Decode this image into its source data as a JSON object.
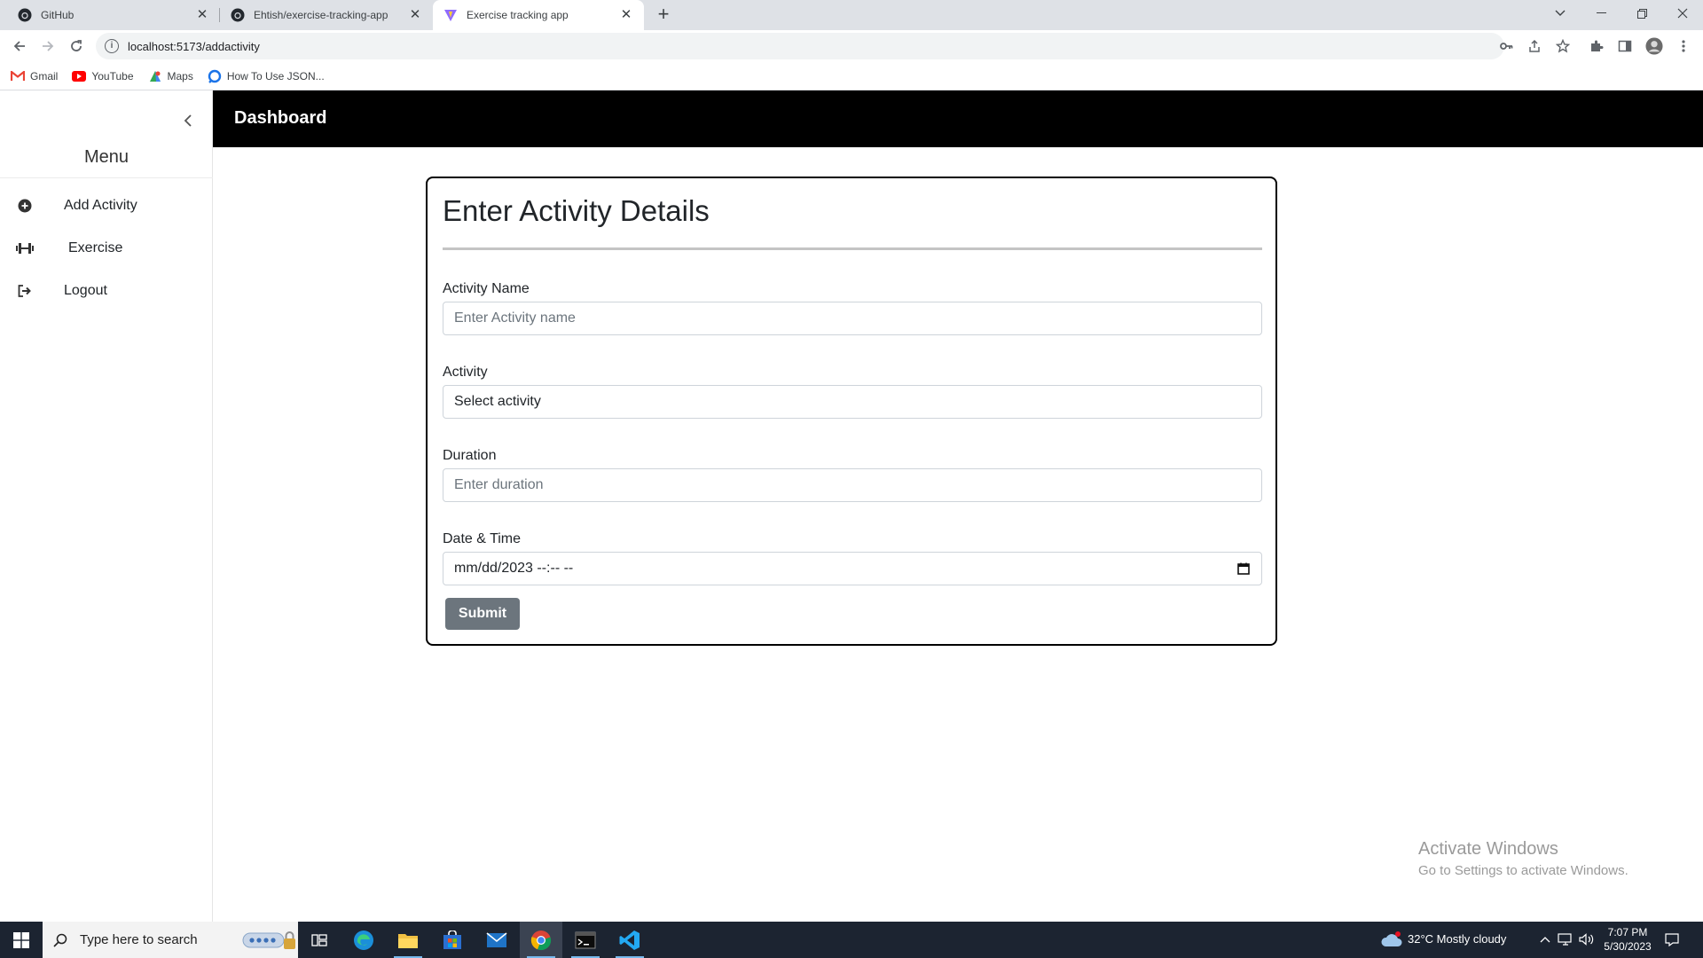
{
  "browser": {
    "tabs": [
      {
        "title": "GitHub",
        "icon": "github-icon"
      },
      {
        "title": "Ehtish/exercise-tracking-app",
        "icon": "github-icon"
      },
      {
        "title": "Exercise tracking app",
        "icon": "vite-icon"
      }
    ],
    "active_tab": 2,
    "url": "localhost:5173/addactivity",
    "bookmarks": [
      {
        "label": "Gmail",
        "icon": "gmail-icon"
      },
      {
        "label": "YouTube",
        "icon": "youtube-icon"
      },
      {
        "label": "Maps",
        "icon": "maps-icon"
      },
      {
        "label": "How To Use JSON...",
        "icon": "json-icon"
      }
    ]
  },
  "sidebar": {
    "title": "Menu",
    "items": [
      {
        "label": "Add Activity",
        "icon": "plus-circle-icon"
      },
      {
        "label": "Exercise",
        "icon": "dumbbell-icon"
      },
      {
        "label": "Logout",
        "icon": "logout-icon"
      }
    ]
  },
  "header": {
    "title": "Dashboard"
  },
  "form": {
    "heading": "Enter Activity Details",
    "activity_name": {
      "label": "Activity Name",
      "placeholder": "Enter Activity name"
    },
    "activity": {
      "label": "Activity",
      "selected": "Select activity"
    },
    "duration": {
      "label": "Duration",
      "placeholder": "Enter duration"
    },
    "datetime": {
      "label": "Date & Time",
      "value": "mm/dd/2023 --:-- --"
    },
    "submit_label": "Submit"
  },
  "watermark": {
    "line1": "Activate Windows",
    "line2": "Go to Settings to activate Windows."
  },
  "taskbar": {
    "search_placeholder": "Type here to search",
    "weather": "32°C  Mostly cloudy",
    "time": "7:07 PM",
    "date": "5/30/2023"
  },
  "colors": {
    "header_bg": "#000000",
    "submit_bg": "#6c757d",
    "taskbar_bg": "#1c2431"
  }
}
